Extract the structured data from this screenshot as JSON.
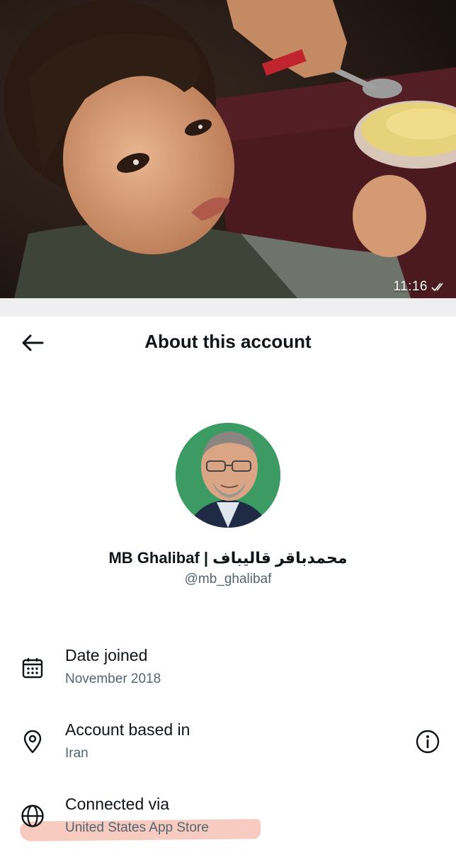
{
  "message": {
    "time": "11:16",
    "status_icon": "double-check-icon"
  },
  "header": {
    "back_icon": "back-arrow-icon",
    "title": "About this account"
  },
  "profile": {
    "avatar_background": "#2e8b57",
    "display_name": "MB Ghalibaf | محمدباقر قالیباف",
    "handle": "@mb_ghalibaf"
  },
  "details": [
    {
      "icon": "calendar-icon",
      "label": "Date joined",
      "value": "November 2018"
    },
    {
      "icon": "location-pin-icon",
      "label": "Account based in",
      "value": "Iran",
      "action_icon": "info-circle-icon"
    },
    {
      "icon": "globe-icon",
      "label": "Connected via",
      "value": "United States App Store"
    }
  ],
  "colors": {
    "text_primary": "#0f1419",
    "text_secondary": "#536471",
    "highlight": "#f0a08c"
  }
}
